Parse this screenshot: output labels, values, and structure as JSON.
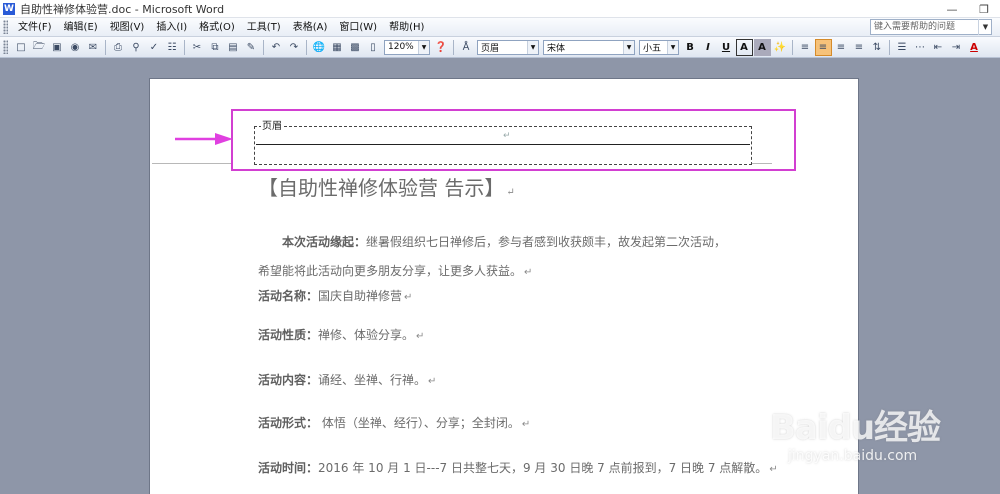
{
  "window": {
    "title": "自助性禅修体验营.doc - Microsoft Word",
    "buttons": [
      "minimize",
      "restore"
    ]
  },
  "menu": {
    "items": [
      "文件(F)",
      "编辑(E)",
      "视图(V)",
      "插入(I)",
      "格式(O)",
      "工具(T)",
      "表格(A)",
      "窗口(W)",
      "帮助(H)"
    ],
    "help_placeholder": "键入需要帮助的问题"
  },
  "toolbar": {
    "zoom": "120%",
    "style": "页眉",
    "font": "宋体",
    "size": "小五",
    "bold": "B",
    "italic": "I",
    "underline": "U",
    "char_border": "A",
    "char_shade": "A",
    "font_color": "A"
  },
  "header_area": {
    "label": "页眉",
    "para_mark": "↵",
    "highlight_color": "#d23fd1"
  },
  "document": {
    "title": "【自助性禅修体验营 告示】",
    "para_mark": "↵",
    "intro_label": "本次活动缘起：",
    "intro_text_1": "继暑假组织七日禅修后，参与者感到收获颇丰，故发起第二次活动，",
    "intro_text_2": "希望能将此活动向更多朋友分享，让更多人获益。",
    "items": [
      {
        "label": "活动名称：",
        "value": "国庆自助禅修营"
      },
      {
        "label": "活动性质：",
        "value": "禅修、体验分享。"
      },
      {
        "label": "活动内容：",
        "value": "诵经、坐禅、行禅。"
      },
      {
        "label": "活动形式：",
        "value": " 体悟（坐禅、经行）、分享；全封闭。"
      },
      {
        "label": "活动时间：",
        "value": "2016 年 10 月 1 日---7 日共整七天，9 月 30 日晚 7 点前报到，7 日晚 7 点解散。"
      }
    ]
  },
  "watermark": {
    "brand": "Baidu经验",
    "url": "jingyan.baidu.com"
  }
}
